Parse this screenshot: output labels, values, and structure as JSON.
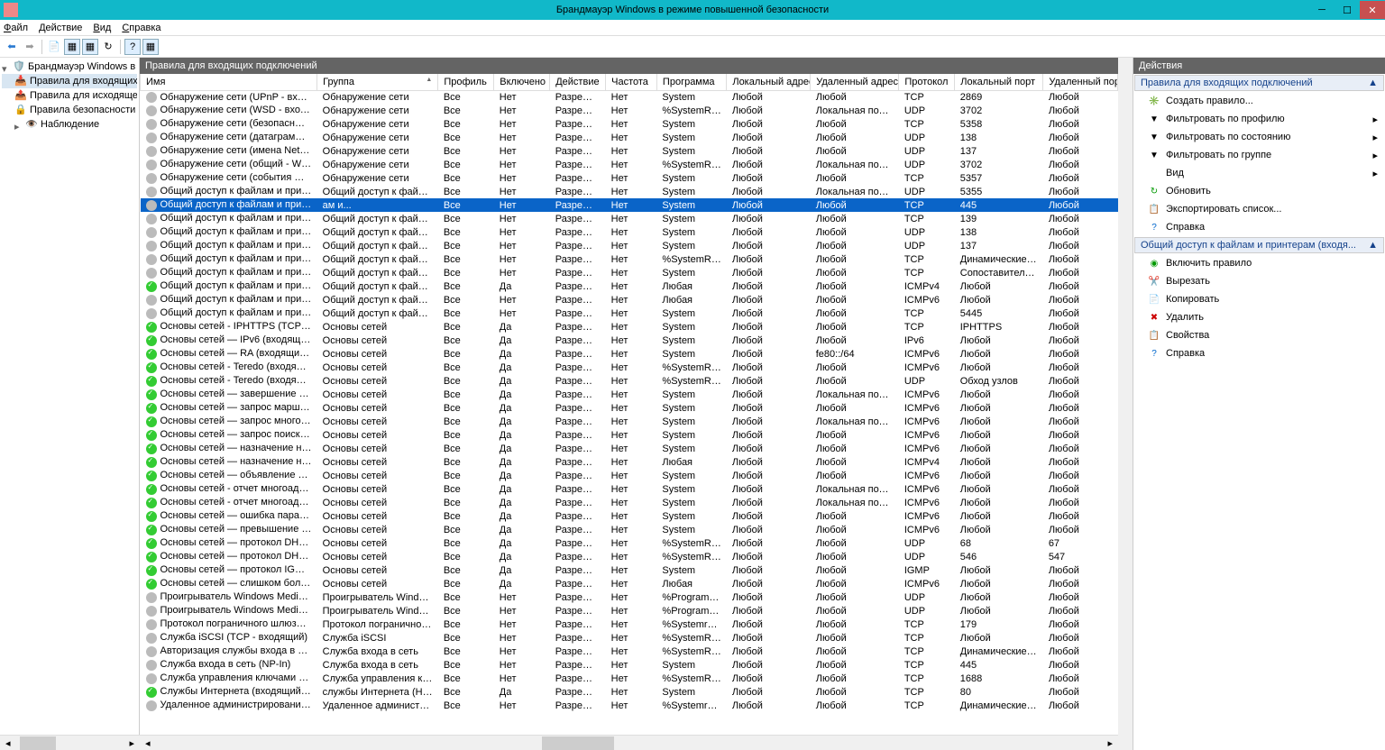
{
  "window": {
    "title": "Брандмауэр Windows в режиме повышенной безопасности"
  },
  "menu": {
    "file": "Файл",
    "action": "Действие",
    "view": "Вид",
    "help": "Справка"
  },
  "tree": {
    "root": "Брандмауэр Windows в режи",
    "inbound": "Правила для входящих по",
    "outbound": "Правила для исходящего п",
    "connsec": "Правила безопасности по",
    "monitoring": "Наблюдение"
  },
  "center_header": "Правила для входящих подключений",
  "columns": [
    "Имя",
    "Группа",
    "Профиль",
    "Включено",
    "Действие",
    "Частота",
    "Программа",
    "Локальный адрес",
    "Удаленный адрес",
    "Протокол",
    "Локальный порт",
    "Удаленный пор"
  ],
  "rows": [
    {
      "on": 0,
      "n": "Обнаружение сети (UPnP - входящий)",
      "g": "Обнаружение сети",
      "p": "Все",
      "e": "Нет",
      "a": "Разрешить",
      "f": "Нет",
      "pr": "System",
      "la": "Любой",
      "ra": "Любой",
      "pt": "TCP",
      "lp": "2869",
      "rp": "Любой"
    },
    {
      "on": 0,
      "n": "Обнаружение сети (WSD - входящий)",
      "g": "Обнаружение сети",
      "p": "Все",
      "e": "Нет",
      "a": "Разрешить",
      "f": "Нет",
      "pr": "%SystemRoo...",
      "la": "Любой",
      "ra": "Локальная подсеть",
      "pt": "UDP",
      "lp": "3702",
      "rp": "Любой"
    },
    {
      "on": 0,
      "n": "Обнаружение сети (безопасные событ...",
      "g": "Обнаружение сети",
      "p": "Все",
      "e": "Нет",
      "a": "Разрешить",
      "f": "Нет",
      "pr": "System",
      "la": "Любой",
      "ra": "Любой",
      "pt": "TCP",
      "lp": "5358",
      "rp": "Любой"
    },
    {
      "on": 0,
      "n": "Обнаружение сети (датаграммы NetBi...",
      "g": "Обнаружение сети",
      "p": "Все",
      "e": "Нет",
      "a": "Разрешить",
      "f": "Нет",
      "pr": "System",
      "la": "Любой",
      "ra": "Любой",
      "pt": "UDP",
      "lp": "138",
      "rp": "Любой"
    },
    {
      "on": 0,
      "n": "Обнаружение сети (имена NetBios - в...",
      "g": "Обнаружение сети",
      "p": "Все",
      "e": "Нет",
      "a": "Разрешить",
      "f": "Нет",
      "pr": "System",
      "la": "Любой",
      "ra": "Любой",
      "pt": "UDP",
      "lp": "137",
      "rp": "Любой"
    },
    {
      "on": 0,
      "n": "Обнаружение сети (общий - WSD - вхо...",
      "g": "Обнаружение сети",
      "p": "Все",
      "e": "Нет",
      "a": "Разрешить",
      "f": "Нет",
      "pr": "%SystemRoo...",
      "la": "Любой",
      "ra": "Локальная подсеть",
      "pt": "UDP",
      "lp": "3702",
      "rp": "Любой"
    },
    {
      "on": 0,
      "n": "Обнаружение сети (события WSD - вхо...",
      "g": "Обнаружение сети",
      "p": "Все",
      "e": "Нет",
      "a": "Разрешить",
      "f": "Нет",
      "pr": "System",
      "la": "Любой",
      "ra": "Любой",
      "pt": "TCP",
      "lp": "5357",
      "rp": "Любой"
    },
    {
      "on": 0,
      "n": "Общий доступ к файлам и принтерам ...",
      "g": "Общий доступ к файлам и...",
      "p": "Все",
      "e": "Нет",
      "a": "Разрешить",
      "f": "Нет",
      "pr": "System",
      "la": "Любой",
      "ra": "Локальная подсеть",
      "pt": "UDP",
      "lp": "5355",
      "rp": "Любой"
    },
    {
      "on": 0,
      "sel": 1,
      "n": "Общий доступ к файлам и принтерам (входящий трафик SMB)",
      "g": "ам и...",
      "p": "Все",
      "e": "Нет",
      "a": "Разрешить",
      "f": "Нет",
      "pr": "System",
      "la": "Любой",
      "ra": "Любой",
      "pt": "TCP",
      "lp": "445",
      "rp": "Любой"
    },
    {
      "on": 0,
      "n": "Общий доступ к файлам и принтерам ...",
      "g": "Общий доступ к файлам и...",
      "p": "Все",
      "e": "Нет",
      "a": "Разрешить",
      "f": "Нет",
      "pr": "System",
      "la": "Любой",
      "ra": "Любой",
      "pt": "TCP",
      "lp": "139",
      "rp": "Любой"
    },
    {
      "on": 0,
      "n": "Общий доступ к файлам и принтерам ...",
      "g": "Общий доступ к файлам и...",
      "p": "Все",
      "e": "Нет",
      "a": "Разрешить",
      "f": "Нет",
      "pr": "System",
      "la": "Любой",
      "ra": "Любой",
      "pt": "UDP",
      "lp": "138",
      "rp": "Любой"
    },
    {
      "on": 0,
      "n": "Общий доступ к файлам и принтерам ...",
      "g": "Общий доступ к файлам и...",
      "p": "Все",
      "e": "Нет",
      "a": "Разрешить",
      "f": "Нет",
      "pr": "System",
      "la": "Любой",
      "ra": "Любой",
      "pt": "UDP",
      "lp": "137",
      "rp": "Любой"
    },
    {
      "on": 0,
      "n": "Общий доступ к файлам и принтерам ...",
      "g": "Общий доступ к файлам и...",
      "p": "Все",
      "e": "Нет",
      "a": "Разрешить",
      "f": "Нет",
      "pr": "%SystemRoo...",
      "la": "Любой",
      "ra": "Любой",
      "pt": "TCP",
      "lp": "Динамические п...",
      "rp": "Любой"
    },
    {
      "on": 0,
      "n": "Общий доступ к файлам и принтерам ...",
      "g": "Общий доступ к файлам и...",
      "p": "Все",
      "e": "Нет",
      "a": "Разрешить",
      "f": "Нет",
      "pr": "System",
      "la": "Любой",
      "ra": "Любой",
      "pt": "TCP",
      "lp": "Сопоставитель к...",
      "rp": "Любой"
    },
    {
      "on": 1,
      "n": "Общий доступ к файлам и принтерам ...",
      "g": "Общий доступ к файлам и...",
      "p": "Все",
      "e": "Да",
      "a": "Разрешить",
      "f": "Нет",
      "pr": "Любая",
      "la": "Любой",
      "ra": "Любой",
      "pt": "ICMPv4",
      "lp": "Любой",
      "rp": "Любой"
    },
    {
      "on": 0,
      "n": "Общий доступ к файлам и принтерам ...",
      "g": "Общий доступ к файлам и...",
      "p": "Все",
      "e": "Нет",
      "a": "Разрешить",
      "f": "Нет",
      "pr": "Любая",
      "la": "Любой",
      "ra": "Любой",
      "pt": "ICMPv6",
      "lp": "Любой",
      "rp": "Любой"
    },
    {
      "on": 0,
      "n": "Общий доступ к файлам и принтерам ...",
      "g": "Общий доступ к файлам и...",
      "p": "Все",
      "e": "Нет",
      "a": "Разрешить",
      "f": "Нет",
      "pr": "System",
      "la": "Любой",
      "ra": "Любой",
      "pt": "TCP",
      "lp": "5445",
      "rp": "Любой"
    },
    {
      "on": 1,
      "n": "Основы сетей - IPHTTPS (TCP - входящ...",
      "g": "Основы сетей",
      "p": "Все",
      "e": "Да",
      "a": "Разрешить",
      "f": "Нет",
      "pr": "System",
      "la": "Любой",
      "ra": "Любой",
      "pt": "TCP",
      "lp": "IPHTTPS",
      "rp": "Любой"
    },
    {
      "on": 1,
      "n": "Основы сетей — IPv6 (входящий трафи...",
      "g": "Основы сетей",
      "p": "Все",
      "e": "Да",
      "a": "Разрешить",
      "f": "Нет",
      "pr": "System",
      "la": "Любой",
      "ra": "Любой",
      "pt": "IPv6",
      "lp": "Любой",
      "rp": "Любой"
    },
    {
      "on": 1,
      "n": "Основы сетей — RA (входящий трафик...",
      "g": "Основы сетей",
      "p": "Все",
      "e": "Да",
      "a": "Разрешить",
      "f": "Нет",
      "pr": "System",
      "la": "Любой",
      "ra": "fe80::/64",
      "pt": "ICMPv6",
      "lp": "Любой",
      "rp": "Любой"
    },
    {
      "on": 1,
      "n": "Основы сетей - Teredo (входящий траф...",
      "g": "Основы сетей",
      "p": "Все",
      "e": "Да",
      "a": "Разрешить",
      "f": "Нет",
      "pr": "%SystemRoo...",
      "la": "Любой",
      "ra": "Любой",
      "pt": "ICMPv6",
      "lp": "Любой",
      "rp": "Любой"
    },
    {
      "on": 1,
      "n": "Основы сетей - Teredo (входящий траф...",
      "g": "Основы сетей",
      "p": "Все",
      "e": "Да",
      "a": "Разрешить",
      "f": "Нет",
      "pr": "%SystemRoo...",
      "la": "Любой",
      "ra": "Любой",
      "pt": "UDP",
      "lp": "Обход узлов",
      "rp": "Любой"
    },
    {
      "on": 1,
      "n": "Основы сетей — завершение многоад...",
      "g": "Основы сетей",
      "p": "Все",
      "e": "Да",
      "a": "Разрешить",
      "f": "Нет",
      "pr": "System",
      "la": "Любой",
      "ra": "Локальная подсеть",
      "pt": "ICMPv6",
      "lp": "Любой",
      "rp": "Любой"
    },
    {
      "on": 1,
      "n": "Основы сетей — запрос маршрута (вх...",
      "g": "Основы сетей",
      "p": "Все",
      "e": "Да",
      "a": "Разрешить",
      "f": "Нет",
      "pr": "System",
      "la": "Любой",
      "ra": "Любой",
      "pt": "ICMPv6",
      "lp": "Любой",
      "rp": "Любой"
    },
    {
      "on": 1,
      "n": "Основы сетей — запрос многоадресно...",
      "g": "Основы сетей",
      "p": "Все",
      "e": "Да",
      "a": "Разрешить",
      "f": "Нет",
      "pr": "System",
      "la": "Любой",
      "ra": "Локальная подсеть",
      "pt": "ICMPv6",
      "lp": "Любой",
      "rp": "Любой"
    },
    {
      "on": 1,
      "n": "Основы сетей — запрос поиска соседе...",
      "g": "Основы сетей",
      "p": "Все",
      "e": "Да",
      "a": "Разрешить",
      "f": "Нет",
      "pr": "System",
      "la": "Любой",
      "ra": "Любой",
      "pt": "ICMPv6",
      "lp": "Любой",
      "rp": "Любой"
    },
    {
      "on": 1,
      "n": "Основы сетей — назначение недостиж...",
      "g": "Основы сетей",
      "p": "Все",
      "e": "Да",
      "a": "Разрешить",
      "f": "Нет",
      "pr": "System",
      "la": "Любой",
      "ra": "Любой",
      "pt": "ICMPv6",
      "lp": "Любой",
      "rp": "Любой"
    },
    {
      "on": 1,
      "n": "Основы сетей — назначение недостиж...",
      "g": "Основы сетей",
      "p": "Все",
      "e": "Да",
      "a": "Разрешить",
      "f": "Нет",
      "pr": "Любая",
      "la": "Любой",
      "ra": "Любой",
      "pt": "ICMPv4",
      "lp": "Любой",
      "rp": "Любой"
    },
    {
      "on": 1,
      "n": "Основы сетей — объявление поиска с...",
      "g": "Основы сетей",
      "p": "Все",
      "e": "Да",
      "a": "Разрешить",
      "f": "Нет",
      "pr": "System",
      "la": "Любой",
      "ra": "Любой",
      "pt": "ICMPv6",
      "lp": "Любой",
      "rp": "Любой"
    },
    {
      "on": 1,
      "n": "Основы сетей - отчет многоадресного ...",
      "g": "Основы сетей",
      "p": "Все",
      "e": "Да",
      "a": "Разрешить",
      "f": "Нет",
      "pr": "System",
      "la": "Любой",
      "ra": "Локальная подсеть",
      "pt": "ICMPv6",
      "lp": "Любой",
      "rp": "Любой"
    },
    {
      "on": 1,
      "n": "Основы сетей - отчет многоадресного ...",
      "g": "Основы сетей",
      "p": "Все",
      "e": "Да",
      "a": "Разрешить",
      "f": "Нет",
      "pr": "System",
      "la": "Любой",
      "ra": "Локальная подсеть",
      "pt": "ICMPv6",
      "lp": "Любой",
      "rp": "Любой"
    },
    {
      "on": 1,
      "n": "Основы сетей — ошибка параметра (в...",
      "g": "Основы сетей",
      "p": "Все",
      "e": "Да",
      "a": "Разрешить",
      "f": "Нет",
      "pr": "System",
      "la": "Любой",
      "ra": "Любой",
      "pt": "ICMPv6",
      "lp": "Любой",
      "rp": "Любой"
    },
    {
      "on": 1,
      "n": "Основы сетей — превышение времен...",
      "g": "Основы сетей",
      "p": "Все",
      "e": "Да",
      "a": "Разрешить",
      "f": "Нет",
      "pr": "System",
      "la": "Любой",
      "ra": "Любой",
      "pt": "ICMPv6",
      "lp": "Любой",
      "rp": "Любой"
    },
    {
      "on": 1,
      "n": "Основы сетей — протокол DHCP (Dyna...",
      "g": "Основы сетей",
      "p": "Все",
      "e": "Да",
      "a": "Разрешить",
      "f": "Нет",
      "pr": "%SystemRoo...",
      "la": "Любой",
      "ra": "Любой",
      "pt": "UDP",
      "lp": "68",
      "rp": "67"
    },
    {
      "on": 1,
      "n": "Основы сетей — протокол DHCPv6 (Dy...",
      "g": "Основы сетей",
      "p": "Все",
      "e": "Да",
      "a": "Разрешить",
      "f": "Нет",
      "pr": "%SystemRoo...",
      "la": "Любой",
      "ra": "Любой",
      "pt": "UDP",
      "lp": "546",
      "rp": "547"
    },
    {
      "on": 1,
      "n": "Основы сетей — протокол IGMP (входя...",
      "g": "Основы сетей",
      "p": "Все",
      "e": "Да",
      "a": "Разрешить",
      "f": "Нет",
      "pr": "System",
      "la": "Любой",
      "ra": "Любой",
      "pt": "IGMP",
      "lp": "Любой",
      "rp": "Любой"
    },
    {
      "on": 1,
      "n": "Основы сетей — слишком большой р...",
      "g": "Основы сетей",
      "p": "Все",
      "e": "Да",
      "a": "Разрешить",
      "f": "Нет",
      "pr": "Любая",
      "la": "Любой",
      "ra": "Любой",
      "pt": "ICMPv6",
      "lp": "Любой",
      "rp": "Любой"
    },
    {
      "on": 0,
      "n": "Проигрыватель Windows Media (UDP -...",
      "g": "Проигрыватель Windows ...",
      "p": "Все",
      "e": "Нет",
      "a": "Разрешить",
      "f": "Нет",
      "pr": "%ProgramFil...",
      "la": "Любой",
      "ra": "Любой",
      "pt": "UDP",
      "lp": "Любой",
      "rp": "Любой"
    },
    {
      "on": 0,
      "n": "Проигрыватель Windows Media x86 (U...",
      "g": "Проигрыватель Windows ...",
      "p": "Все",
      "e": "Нет",
      "a": "Разрешить",
      "f": "Нет",
      "pr": "%ProgramFil...",
      "la": "Любой",
      "ra": "Любой",
      "pt": "UDP",
      "lp": "Любой",
      "rp": "Любой"
    },
    {
      "on": 0,
      "n": "Протокол пограничного шлюза (BGP ...",
      "g": "Протокол пограничного ...",
      "p": "Все",
      "e": "Нет",
      "a": "Разрешить",
      "f": "Нет",
      "pr": "%Systemroo...",
      "la": "Любой",
      "ra": "Любой",
      "pt": "TCP",
      "lp": "179",
      "rp": "Любой"
    },
    {
      "on": 0,
      "n": "Служба iSCSI (TCP - входящий)",
      "g": "Служба iSCSI",
      "p": "Все",
      "e": "Нет",
      "a": "Разрешить",
      "f": "Нет",
      "pr": "%SystemRoo...",
      "la": "Любой",
      "ra": "Любой",
      "pt": "TCP",
      "lp": "Любой",
      "rp": "Любой"
    },
    {
      "on": 0,
      "n": "Авторизация службы входа в сеть (RPC)",
      "g": "Служба входа в сеть",
      "p": "Все",
      "e": "Нет",
      "a": "Разрешить",
      "f": "Нет",
      "pr": "%SystemRoo...",
      "la": "Любой",
      "ra": "Любой",
      "pt": "TCP",
      "lp": "Динамические п...",
      "rp": "Любой"
    },
    {
      "on": 0,
      "n": "Служба входа в сеть (NP-In)",
      "g": "Служба входа в сеть",
      "p": "Все",
      "e": "Нет",
      "a": "Разрешить",
      "f": "Нет",
      "pr": "System",
      "la": "Любой",
      "ra": "Любой",
      "pt": "TCP",
      "lp": "445",
      "rp": "Любой"
    },
    {
      "on": 0,
      "n": "Служба управления ключами (входящ...",
      "g": "Служба управления ключ...",
      "p": "Все",
      "e": "Нет",
      "a": "Разрешить",
      "f": "Нет",
      "pr": "%SystemRoo...",
      "la": "Любой",
      "ra": "Любой",
      "pt": "TCP",
      "lp": "1688",
      "rp": "Любой"
    },
    {
      "on": 1,
      "n": "Службы Интернета (входящий трафик ...",
      "g": "службы Интернета  (HTTP)",
      "p": "Все",
      "e": "Да",
      "a": "Разрешить",
      "f": "Нет",
      "pr": "System",
      "la": "Любой",
      "ra": "Любой",
      "pt": "TCP",
      "lp": "80",
      "rp": "Любой"
    },
    {
      "on": 0,
      "n": "Удаленное администрирование COM+ ...",
      "g": "Удаленное администриров...",
      "p": "Все",
      "e": "Нет",
      "a": "Разрешить",
      "f": "Нет",
      "pr": "%Systemroot...",
      "la": "Любой",
      "ra": "Любой",
      "pt": "TCP",
      "lp": "Динамические п...",
      "rp": "Любой"
    }
  ],
  "actions": {
    "hdr": "Действия",
    "sec1": "Правила для входящих подключений",
    "new": "Создать правило...",
    "fprofile": "Фильтровать по профилю",
    "fstate": "Фильтровать по состоянию",
    "fgroup": "Фильтровать по группе",
    "view": "Вид",
    "refresh": "Обновить",
    "export": "Экспортировать список...",
    "help": "Справка",
    "sec2": "Общий доступ к файлам и принтерам (входя...",
    "enable": "Включить правило",
    "cut": "Вырезать",
    "copy": "Копировать",
    "delete": "Удалить",
    "props": "Свойства",
    "help2": "Справка"
  }
}
